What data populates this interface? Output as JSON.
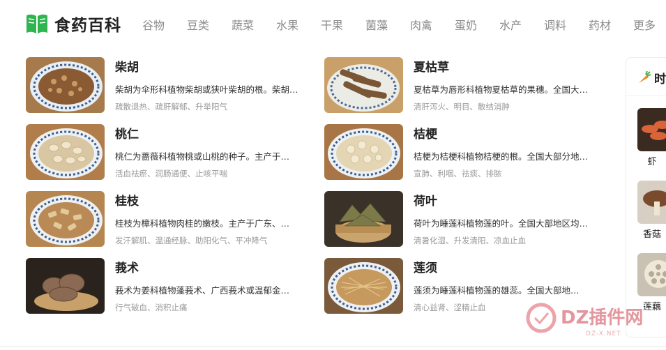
{
  "brand": {
    "name": "食药百科"
  },
  "nav": [
    "谷物",
    "豆类",
    "蔬菜",
    "水果",
    "干果",
    "菌藻",
    "肉禽",
    "蛋奶",
    "水产",
    "调料",
    "药材",
    "更多"
  ],
  "herbs": [
    {
      "name": "柴胡",
      "desc": "柴胡为伞形科植物柴胡或狭叶柴胡的根。柴胡…",
      "tags": "疏散退热、疏肝解郁、升举阳气",
      "image": "chaihu-image"
    },
    {
      "name": "夏枯草",
      "desc": "夏枯草为唇形科植物夏枯草的果穗。全国大…",
      "tags": "清肝泻火、明目、散结消肿",
      "image": "xiakucao-image"
    },
    {
      "name": "桃仁",
      "desc": "桃仁为蔷薇科植物桃或山桃的种子。主产于…",
      "tags": "活血祛瘀、润肠通便、止咳平喘",
      "image": "taoren-image"
    },
    {
      "name": "桔梗",
      "desc": "桔梗为桔梗科植物桔梗的根。全国大部分地…",
      "tags": "宣肺、利咽、祛痰、排脓",
      "image": "jiegeng-image"
    },
    {
      "name": "桂枝",
      "desc": "桂枝为樟科植物肉桂的嫩枝。主产于广东、…",
      "tags": "发汗解肌、温通经脉、助阳化气、平冲降气",
      "image": "guizhi-image"
    },
    {
      "name": "荷叶",
      "desc": "荷叶为睡莲科植物莲的叶。全国大部地区均…",
      "tags": "清暑化湿、升发清阳、凉血止血",
      "image": "heye-image"
    },
    {
      "name": "莪术",
      "desc": "莪术为姜科植物蓬莪术、广西莪术或温郁金…",
      "tags": "行气破血、消积止痛",
      "image": "ezhu-image"
    },
    {
      "name": "莲须",
      "desc": "莲须为睡莲科植物莲的雄蕊。全国大部地…",
      "tags": "清心益肾、涩精止血",
      "image": "lianxu-image"
    }
  ],
  "side": {
    "title": "时",
    "items": [
      {
        "label": "虾"
      },
      {
        "label": "香菇"
      },
      {
        "label": "莲藕"
      }
    ]
  },
  "watermark": {
    "text": "DZ插件网",
    "sub": "DZ-X.NET"
  },
  "colors": {
    "brand_green": "#2fb550",
    "carrot": "#f28a1e",
    "watermark": "#e08b93"
  }
}
